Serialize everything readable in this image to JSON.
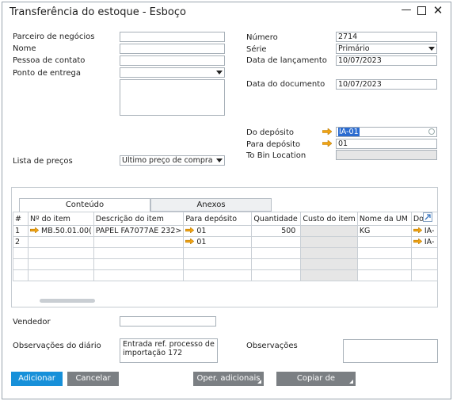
{
  "window": {
    "title": "Transferência do estoque - Esboço"
  },
  "header_left": {
    "partner_label": "Parceiro de negócios",
    "partner_value": "",
    "name_label": "Nome",
    "name_value": "",
    "contact_label": "Pessoa de contato",
    "contact_value": "",
    "delivery_label": "Ponto de entrega",
    "delivery_value": "",
    "price_list_label": "Lista de preços",
    "price_list_value": "Último preço de compra"
  },
  "header_right": {
    "number_label": "Número",
    "number_value": "2714",
    "series_label": "Série",
    "series_value": "Primário",
    "posting_date_label": "Data de lançamento",
    "posting_date_value": "10/07/2023",
    "doc_date_label": "Data do documento",
    "doc_date_value": "10/07/2023",
    "from_wh_label": "Do depósito",
    "from_wh_value": "IA-01",
    "to_wh_label": "Para depósito",
    "to_wh_value": "01",
    "to_bin_label": "To Bin Location",
    "to_bin_value": ""
  },
  "tabs": [
    {
      "label": "Conteúdo"
    },
    {
      "label": "Anexos"
    }
  ],
  "grid": {
    "columns": [
      "#",
      "Nº do item",
      "Descrição do item",
      "Para depósito",
      "Quantidade",
      "Custo do item",
      "Nome da UM",
      "Do..."
    ],
    "rows": [
      {
        "num": "1",
        "item": "MB.50.01.00(",
        "desc": "PAPEL FA7077AE 232>",
        "to_wh": "01",
        "qty": "500",
        "cost": "",
        "uom": "KG",
        "from_wh": "IA-"
      },
      {
        "num": "2",
        "item": "",
        "desc": "",
        "to_wh": "01",
        "qty": "",
        "cost": "",
        "uom": "",
        "from_wh": "IA-"
      }
    ]
  },
  "footer": {
    "seller_label": "Vendedor",
    "seller_value": "",
    "journal_label": "Observações do diário",
    "journal_value": "Entrada ref. processo de importação 172",
    "remarks_label": "Observações",
    "remarks_value": ""
  },
  "buttons": {
    "add": "Adicionar",
    "cancel": "Cancelar",
    "more_ops": "Oper. adicionais",
    "copy_from": "Copiar de"
  },
  "colors": {
    "link_arrow": "#f2a413",
    "primary_button": "#1790d9",
    "secondary_button": "#7b7f83",
    "readonly_field": "#e6e6e6"
  }
}
